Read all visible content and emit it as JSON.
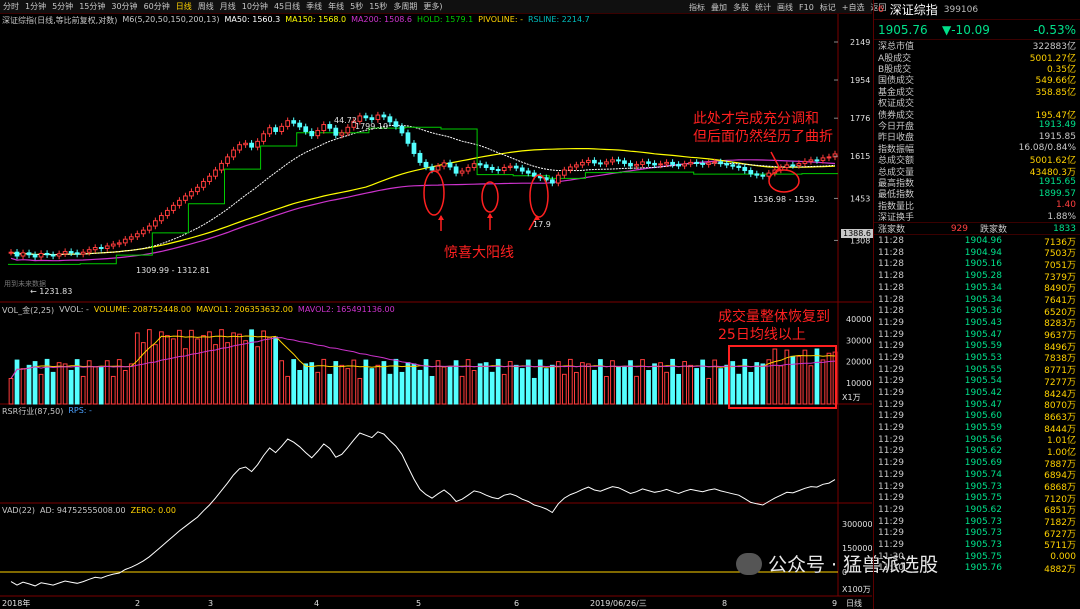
{
  "toolbar": {
    "periods": [
      "分时",
      "1分钟",
      "5分钟",
      "15分钟",
      "30分钟",
      "60分钟",
      "日线",
      "周线",
      "月线",
      "10分钟",
      "45日线",
      "季线",
      "年线",
      "5秒",
      "15秒",
      "多周期",
      "更多)"
    ],
    "active_index": 6,
    "right": [
      "指标",
      "叠加",
      "多股",
      "统计",
      "画线",
      "F10",
      "标记",
      "+自选",
      "返回"
    ]
  },
  "main_info": {
    "title": "深证综指(日线,等比前复权,对数)",
    "m6": "M6(5,20,50,150,200,13)",
    "ma50": "MA50: 1560.3",
    "ma150": "MA150: 1568.0",
    "ma200": "MA200: 1508.6",
    "hold": "HOLD: 1579.1",
    "pivoline": "PIVOLINE: -",
    "rsline": "RSLINE: 2214.7"
  },
  "vol_info": {
    "title": "VOL_金(2,25)",
    "vvol": "VVOL: -",
    "volume": "VOLUME: 208752448.00",
    "mavol1": "MAVOL1: 206353632.00",
    "mavol2": "MAVOL2: 165491136.00"
  },
  "rsr_info": {
    "title": "RSR行业(87,50)",
    "rps": "RPS: -"
  },
  "vad_info": {
    "title": "VAD(22)",
    "ad": "AD: 94752555008.00",
    "zero": "ZERO: 0.00"
  },
  "annotations": {
    "top_right_1": "此处才完成充分调和",
    "top_right_2": "但后面仍然经历了曲折",
    "surprise": "惊喜大阳线",
    "volume_1": "成交量整体恢复到",
    "volume_2": "25日均线以上",
    "low_price": "1309.99 - 1312.81",
    "left_price": "← 1231.83",
    "high_price": "1799.10",
    "high_prefix": "44.72",
    "cur_range": "1536.98 - 1539.",
    "low_mark": "17.9",
    "price_tag": "1388.6",
    "used_label": "用到未来数据"
  },
  "watermark": {
    "text": "公众号 · 猛兽派选股"
  },
  "colors": {
    "up": "#ff3c3c",
    "down": "#54ffff",
    "ma50": "#ffffff",
    "ma150": "#ffff00",
    "ma200": "#cc33cc",
    "hold": "#00cc00",
    "annot": "#ff2020"
  },
  "chart_data": [
    {
      "type": "candlestick",
      "title": "深证综指(日线,等比前复权,对数)",
      "scale": "log",
      "yticks": [
        1308,
        1453,
        1615,
        1776,
        1954,
        2149
      ],
      "xticks": [
        "2018年",
        "2",
        "3",
        "4",
        "5",
        "6",
        "2019/06/26/三",
        "8",
        "9"
      ],
      "close": [
        1270,
        1258,
        1268,
        1262,
        1255,
        1266,
        1262,
        1258,
        1265,
        1272,
        1268,
        1264,
        1270,
        1278,
        1285,
        1282,
        1290,
        1296,
        1300,
        1312,
        1320,
        1330,
        1342,
        1356,
        1374,
        1392,
        1410,
        1428,
        1446,
        1462,
        1478,
        1494,
        1516,
        1536,
        1560,
        1586,
        1612,
        1640,
        1662,
        1668,
        1652,
        1676,
        1708,
        1734,
        1718,
        1740,
        1765,
        1754,
        1738,
        1718,
        1700,
        1722,
        1748,
        1732,
        1702,
        1712,
        1736,
        1762,
        1786,
        1778,
        1770,
        1790,
        1782,
        1760,
        1740,
        1712,
        1668,
        1626,
        1590,
        1572,
        1560,
        1575,
        1588,
        1572,
        1548,
        1556,
        1570,
        1585,
        1580,
        1570,
        1562,
        1558,
        1570,
        1575,
        1568,
        1556,
        1548,
        1536,
        1530,
        1522,
        1510,
        1540,
        1560,
        1572,
        1580,
        1590,
        1598,
        1588,
        1584,
        1592,
        1600,
        1596,
        1586,
        1576,
        1582,
        1592,
        1586,
        1580,
        1584,
        1590,
        1582,
        1576,
        1584,
        1590,
        1586,
        1582,
        1588,
        1592,
        1585,
        1580,
        1575,
        1570,
        1558,
        1545,
        1540,
        1536,
        1548,
        1560,
        1570,
        1580,
        1578,
        1586,
        1594,
        1600,
        1598,
        1608,
        1612,
        1624
      ],
      "ma50": "overlay",
      "ma150": "overlay",
      "ma200": "overlay"
    },
    {
      "type": "bar",
      "title": "VOL_金(2,25)",
      "yticks": [
        10000,
        20000,
        30000,
        40000
      ],
      "unit": "X1万"
    },
    {
      "type": "line",
      "title": "VAD(22)",
      "yticks": [
        0,
        150000,
        300000
      ],
      "unit": "X100万"
    }
  ],
  "right_panel": {
    "num": "6",
    "name": "深证综指",
    "code": "399106",
    "price": "1905.76",
    "change": "▼-10.09",
    "pct": "-0.53%",
    "fields": [
      {
        "k": "深总市值",
        "v": "322883亿",
        "c": "#c8c8c8"
      },
      {
        "k": "A股成交",
        "v": "5001.27亿",
        "c": "#ffd200"
      },
      {
        "k": "B股成交",
        "v": "0.35亿",
        "c": "#ffd200"
      },
      {
        "k": "国债成交",
        "v": "549.66亿",
        "c": "#ffd200"
      },
      {
        "k": "基金成交",
        "v": "358.85亿",
        "c": "#ffd200"
      },
      {
        "k": "权证成交",
        "v": "",
        "c": "#ffd200"
      },
      {
        "k": "债券成交",
        "v": "195.47亿",
        "c": "#ffd200"
      },
      {
        "k": "今日开盘",
        "v": "1913.49",
        "c": "#00e08a"
      },
      {
        "k": "昨日收盘",
        "v": "1915.85",
        "c": "#c8c8c8"
      },
      {
        "k": "指数振幅",
        "v": "16.08/0.84%",
        "c": "#c8c8c8"
      },
      {
        "k": "总成交额",
        "v": "5001.62亿",
        "c": "#ffd200"
      },
      {
        "k": "总成交量",
        "v": "43480.3万",
        "c": "#ffd200"
      },
      {
        "k": "最高指数",
        "v": "1915.65",
        "c": "#00e08a"
      },
      {
        "k": "最低指数",
        "v": "1899.57",
        "c": "#00e08a"
      },
      {
        "k": "指数量比",
        "v": "1.40",
        "c": "#ff4040"
      },
      {
        "k": "深证换手",
        "v": "1.88%",
        "c": "#c8c8c8"
      }
    ],
    "up_label": "涨家数",
    "up_count": "929",
    "down_label": "跌家数",
    "down_count": "1833",
    "ticks": [
      {
        "t": "11:28",
        "p": "1904.96",
        "q": "7136万"
      },
      {
        "t": "11:28",
        "p": "1904.94",
        "q": "7503万"
      },
      {
        "t": "11:28",
        "p": "1905.16",
        "q": "7051万"
      },
      {
        "t": "11:28",
        "p": "1905.28",
        "q": "7379万"
      },
      {
        "t": "11:28",
        "p": "1905.34",
        "q": "8490万"
      },
      {
        "t": "11:28",
        "p": "1905.34",
        "q": "7641万"
      },
      {
        "t": "11:28",
        "p": "1905.36",
        "q": "6520万"
      },
      {
        "t": "11:29",
        "p": "1905.43",
        "q": "8283万"
      },
      {
        "t": "11:29",
        "p": "1905.47",
        "q": "9637万"
      },
      {
        "t": "11:29",
        "p": "1905.59",
        "q": "8496万"
      },
      {
        "t": "11:29",
        "p": "1905.53",
        "q": "7838万"
      },
      {
        "t": "11:29",
        "p": "1905.55",
        "q": "8771万"
      },
      {
        "t": "11:29",
        "p": "1905.54",
        "q": "7277万"
      },
      {
        "t": "11:29",
        "p": "1905.42",
        "q": "8424万"
      },
      {
        "t": "11:29",
        "p": "1905.47",
        "q": "8070万"
      },
      {
        "t": "11:29",
        "p": "1905.60",
        "q": "8663万"
      },
      {
        "t": "11:29",
        "p": "1905.59",
        "q": "8444万"
      },
      {
        "t": "11:29",
        "p": "1905.56",
        "q": "1.01亿"
      },
      {
        "t": "11:29",
        "p": "1905.62",
        "q": "1.00亿"
      },
      {
        "t": "11:29",
        "p": "1905.69",
        "q": "7887万"
      },
      {
        "t": "11:29",
        "p": "1905.74",
        "q": "6894万"
      },
      {
        "t": "11:29",
        "p": "1905.73",
        "q": "6868万"
      },
      {
        "t": "11:29",
        "p": "1905.75",
        "q": "7120万"
      },
      {
        "t": "11:29",
        "p": "1905.62",
        "q": "6851万"
      },
      {
        "t": "11:29",
        "p": "1905.73",
        "q": "7182万"
      },
      {
        "t": "11:29",
        "p": "1905.73",
        "q": "6727万"
      },
      {
        "t": "11:29",
        "p": "1905.73",
        "q": "5711万"
      },
      {
        "t": "11:30",
        "p": "1905.75",
        "q": "0.000"
      },
      {
        "t": "11:30",
        "p": "1905.76",
        "q": "4882万"
      }
    ]
  }
}
